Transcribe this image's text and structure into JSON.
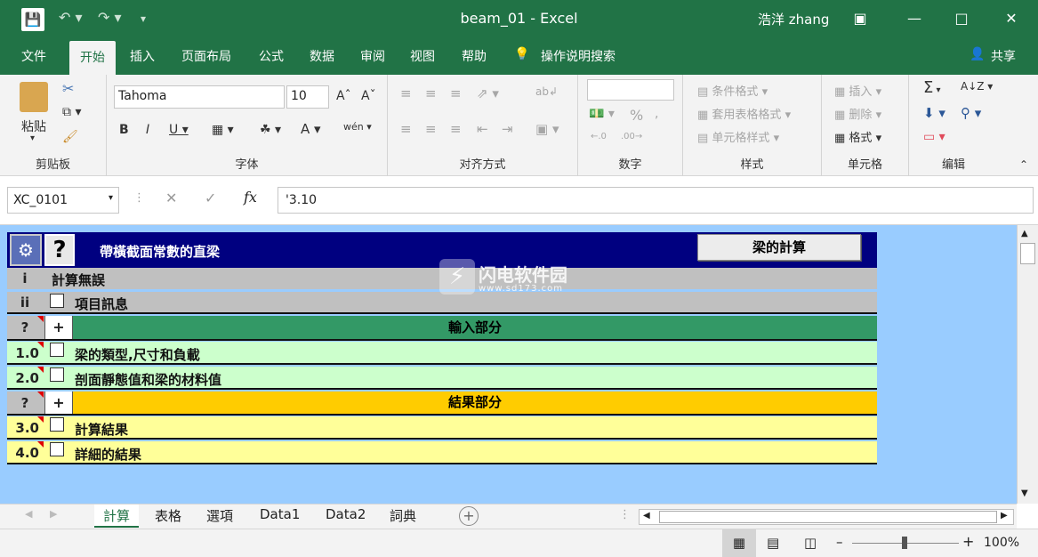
{
  "app": {
    "title": "beam_01  -  Excel",
    "user": "浩洋 zhang",
    "share": "共享",
    "tell_me": "操作说明搜索"
  },
  "ribbon_tabs": [
    "文件",
    "开始",
    "插入",
    "页面布局",
    "公式",
    "数据",
    "审阅",
    "视图",
    "帮助"
  ],
  "ribbon": {
    "clipboard": {
      "paste": "粘贴",
      "label": "剪贴板"
    },
    "font": {
      "name": "Tahoma",
      "size": "10",
      "label": "字体"
    },
    "alignment": {
      "label": "对齐方式"
    },
    "number": {
      "label": "数字",
      "percent": "%"
    },
    "styles": {
      "cond": "条件格式",
      "table": "套用表格格式",
      "cell": "单元格样式",
      "label": "样式"
    },
    "cells": {
      "insert": "插入",
      "delete": "删除",
      "format": "格式",
      "label": "单元格"
    },
    "editing": {
      "label": "编辑"
    }
  },
  "formula_bar": {
    "name_box": "XC_0101",
    "formula": "'3.10"
  },
  "sheet": {
    "header_title": "帶橫截面常數的直梁",
    "calc_button": "梁的計算",
    "help_icon": "?",
    "rows": [
      {
        "num": "i",
        "label": "計算無誤",
        "check": false
      },
      {
        "num": "ii",
        "label": "項目訊息",
        "check": true
      },
      {
        "num": "?",
        "label": "輸入部分",
        "plus": "+",
        "section": true
      },
      {
        "num": "1.0",
        "label": "梁的類型,尺寸和負載",
        "check": true
      },
      {
        "num": "2.0",
        "label": "剖面靜態值和梁的材料值",
        "check": true
      },
      {
        "num": "?",
        "label": "結果部分",
        "plus": "+",
        "section": true
      },
      {
        "num": "3.0",
        "label": "計算結果",
        "check": true
      },
      {
        "num": "4.0",
        "label": "詳細的結果",
        "check": true
      }
    ],
    "watermark": "闪电软件园",
    "watermark_url": "www.sd173.com"
  },
  "sheet_tabs": [
    "計算",
    "表格",
    "選項",
    "Data1",
    "Data2",
    "詞典"
  ],
  "status": {
    "zoom": "100%"
  },
  "colors": {
    "excel_green": "#217346",
    "sheet_bg": "#99ccff",
    "header_navy": "#000080",
    "input_green": "#339966",
    "input_row": "#ccffcc",
    "result_gold": "#ffcc00",
    "result_row": "#ffff99"
  }
}
